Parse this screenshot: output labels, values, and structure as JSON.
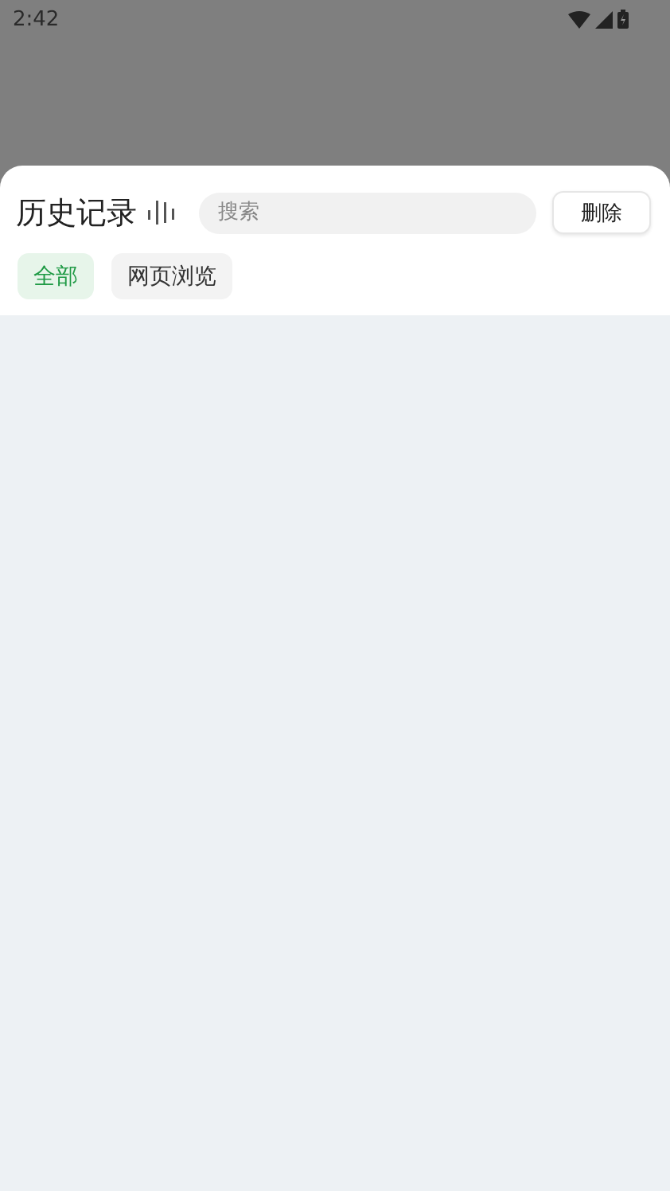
{
  "status_bar": {
    "time": "2:42"
  },
  "header": {
    "title": "历史记录",
    "search": {
      "placeholder": "搜索"
    },
    "delete_button": "删除"
  },
  "filters": [
    {
      "label": "全部",
      "selected": true
    },
    {
      "label": "网页浏览",
      "selected": false
    }
  ]
}
